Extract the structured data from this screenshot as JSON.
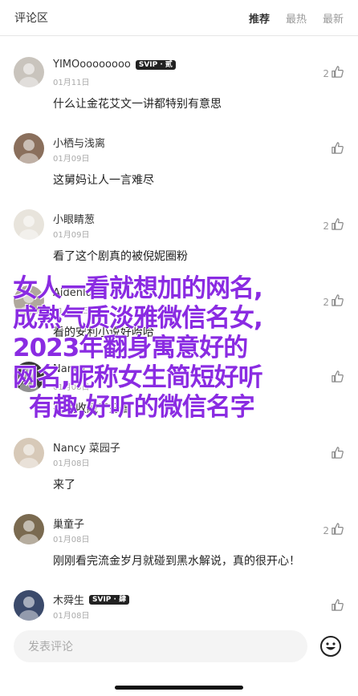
{
  "header": {
    "title": "评论区",
    "tabs": [
      {
        "label": "推荐",
        "active": true
      },
      {
        "label": "最热",
        "active": false
      },
      {
        "label": "最新",
        "active": false
      }
    ]
  },
  "comments": [
    {
      "user": "YIMOoooooooo",
      "badge": "SVIP · 贰",
      "date": "01月11日",
      "text": "什么让金花艾文一讲都特别有意思",
      "likes": "2"
    },
    {
      "user": "小栖与浅离",
      "badge": "",
      "date": "01月09日",
      "text": "这舅妈让人一言难尽",
      "likes": ""
    },
    {
      "user": "小眼睛葱",
      "badge": "",
      "date": "01月09日",
      "text": "看了这个剧真的被倪妮圈粉",
      "likes": "2"
    },
    {
      "user": "Aidenlulu",
      "badge": "",
      "date": "01月08日",
      "text": "看的安利小说好哈哈",
      "likes": "2"
    },
    {
      "user": "Nancy",
      "badge": "",
      "date": "01月08日",
      "text": "有趣收藏了好看",
      "likes": ""
    },
    {
      "user": "Nancy 菜园子",
      "badge": "",
      "date": "01月08日",
      "text": "来了",
      "likes": ""
    },
    {
      "user": "巢童子",
      "badge": "",
      "date": "01月08日",
      "text": "刚刚看完流金岁月就碰到黑水解说，真的很开心！",
      "likes": "2"
    },
    {
      "user": "木舜生",
      "badge": "SVIP · 肆",
      "date": "01月08日",
      "text": "",
      "likes": ""
    }
  ],
  "overlay": {
    "lines": [
      "女人一看就想加的网名,",
      "成熟气质淡雅微信名女,",
      "2023年翻身寓意好的",
      "网名,昵称女生简短好听",
      "有趣,好听的微信名字"
    ],
    "color": "#8a2be2"
  },
  "composer": {
    "placeholder": "发表评论",
    "emoji_icon": "smiley-icon"
  },
  "colors": {
    "text": "#222222",
    "muted": "#aaaaaa",
    "badge_bg": "#222222"
  }
}
